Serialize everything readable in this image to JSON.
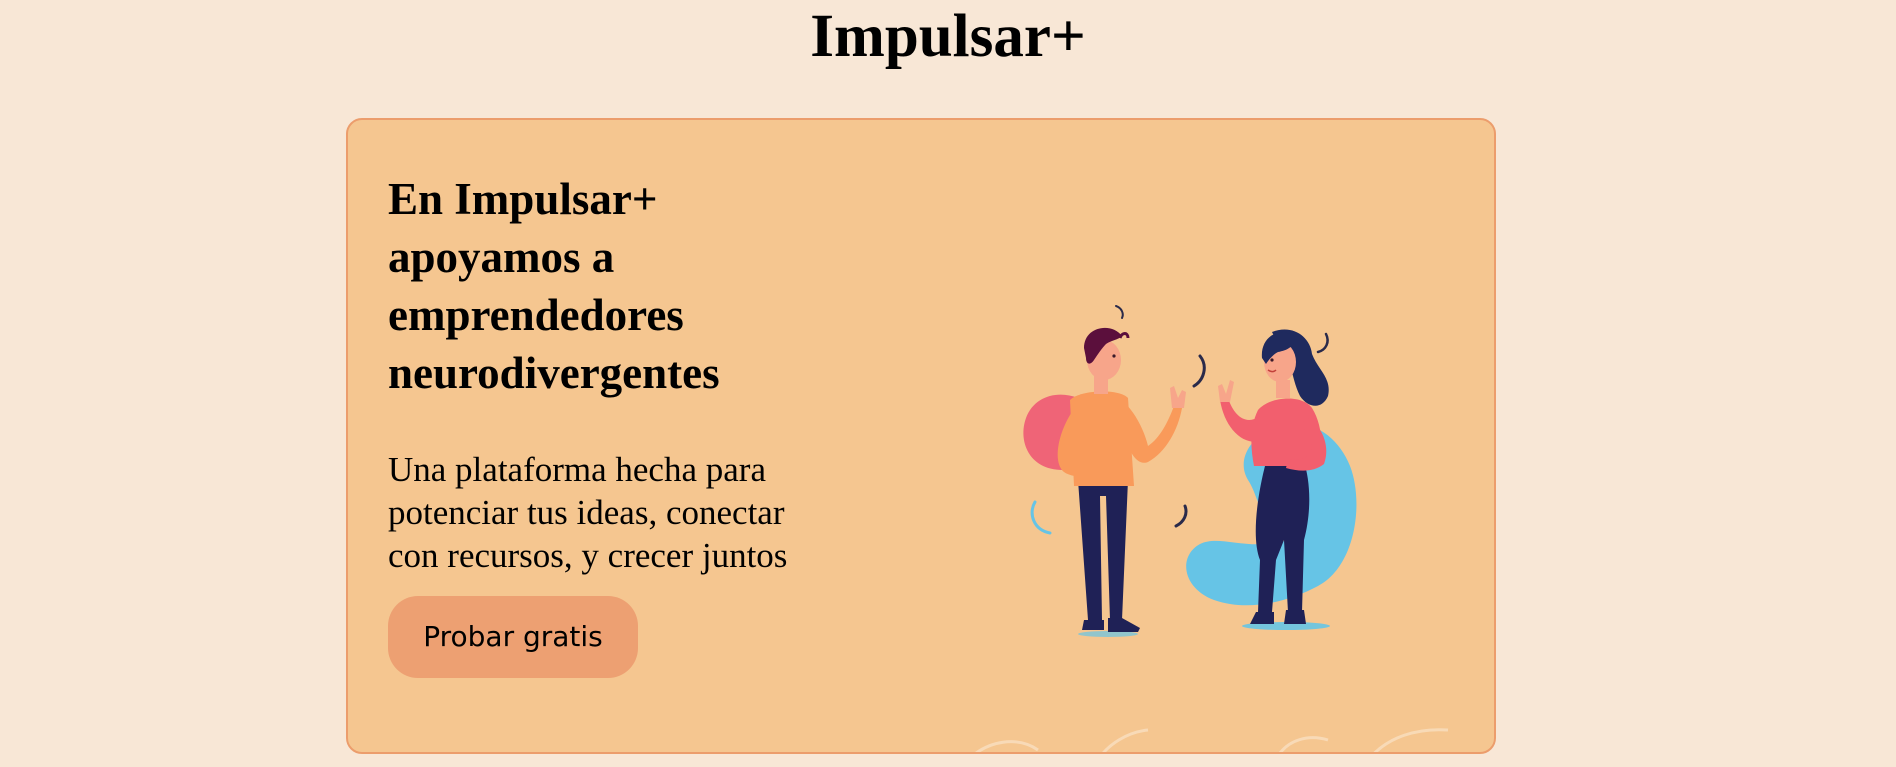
{
  "header": {
    "title": "Impulsar+"
  },
  "hero": {
    "heading": "En Impulsar+ apoyamos a emprendedores neurodivergentes",
    "description": "Una plataforma hecha para potenciar tus ideas, conectar con recursos, y crecer juntos",
    "cta_label": "Probar gratis",
    "illustration": "two-people-talking-illustration"
  },
  "colors": {
    "page_background": "#f8e7d6",
    "card_background": "#f5c690",
    "card_border": "#ec9d6c",
    "button_background": "#eda072",
    "man_shirt": "#f99a5a",
    "woman_shirt": "#f25f6e",
    "pants": "#1f2156",
    "blob_blue": "#66c4e6",
    "blob_pink": "#ef6477",
    "blob_purple": "#b784c3",
    "hair_man": "#5b0f3c",
    "hair_woman": "#1f2a5e",
    "skin": "#f7a58a"
  }
}
